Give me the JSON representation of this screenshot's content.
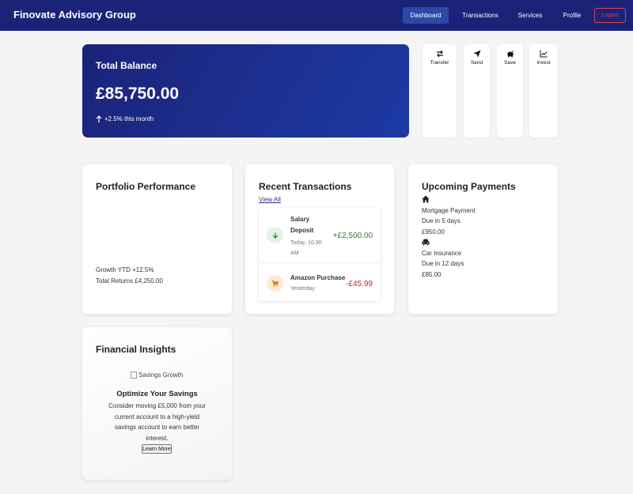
{
  "header": {
    "brand": "Finovate Advisory Group",
    "nav": [
      "Dashboard",
      "Transactions",
      "Services",
      "Profile"
    ],
    "active_nav": "Dashboard",
    "logout_label": "Logout"
  },
  "balance": {
    "label": "Total Balance",
    "amount": "£85,750.00",
    "change": "+2.5% this month"
  },
  "quick_actions": [
    {
      "label": "Transfer",
      "icon": "transfer-icon"
    },
    {
      "label": "Send",
      "icon": "send-icon"
    },
    {
      "label": "Save",
      "icon": "piggy-bank-icon"
    },
    {
      "label": "Invest",
      "icon": "chart-icon"
    }
  ],
  "portfolio": {
    "title": "Portfolio Performance",
    "growth": "Growth YTD +12.5%",
    "returns": "Total Returns £4,250.00"
  },
  "transactions": {
    "title": "Recent Transactions",
    "view_all": "View All",
    "items": [
      {
        "name": "Salary Deposit",
        "time": "Today, 10:30 AM",
        "amount": "+£2,500.00",
        "icon": "arrow-down-icon"
      },
      {
        "name": "Amazon Purchase",
        "time": "Yesterday",
        "amount": "-£45.99",
        "icon": "cart-icon"
      }
    ]
  },
  "payments": {
    "title": "Upcoming Payments",
    "items": [
      {
        "name": "Mortgage Payment",
        "due": "Due in 5 days",
        "amount": "£950.00",
        "icon": "home-icon"
      },
      {
        "name": "Car Insurance",
        "due": "Due in 12 days",
        "amount": "£85.00",
        "icon": "car-icon"
      }
    ]
  },
  "insights": {
    "title": "Financial Insights",
    "image_alt": "Savings Growth",
    "heading": "Optimize Your Savings",
    "body": "Consider moving £5,000 from your current account to a high-yield savings account to earn better interest.",
    "button": "Learn More"
  },
  "colors": {
    "header_bg": "#1b2379",
    "nav_active_bg": "#2b49a6",
    "logout": "#e0434b",
    "positive": "#2e7d32",
    "negative": "#c62828"
  }
}
